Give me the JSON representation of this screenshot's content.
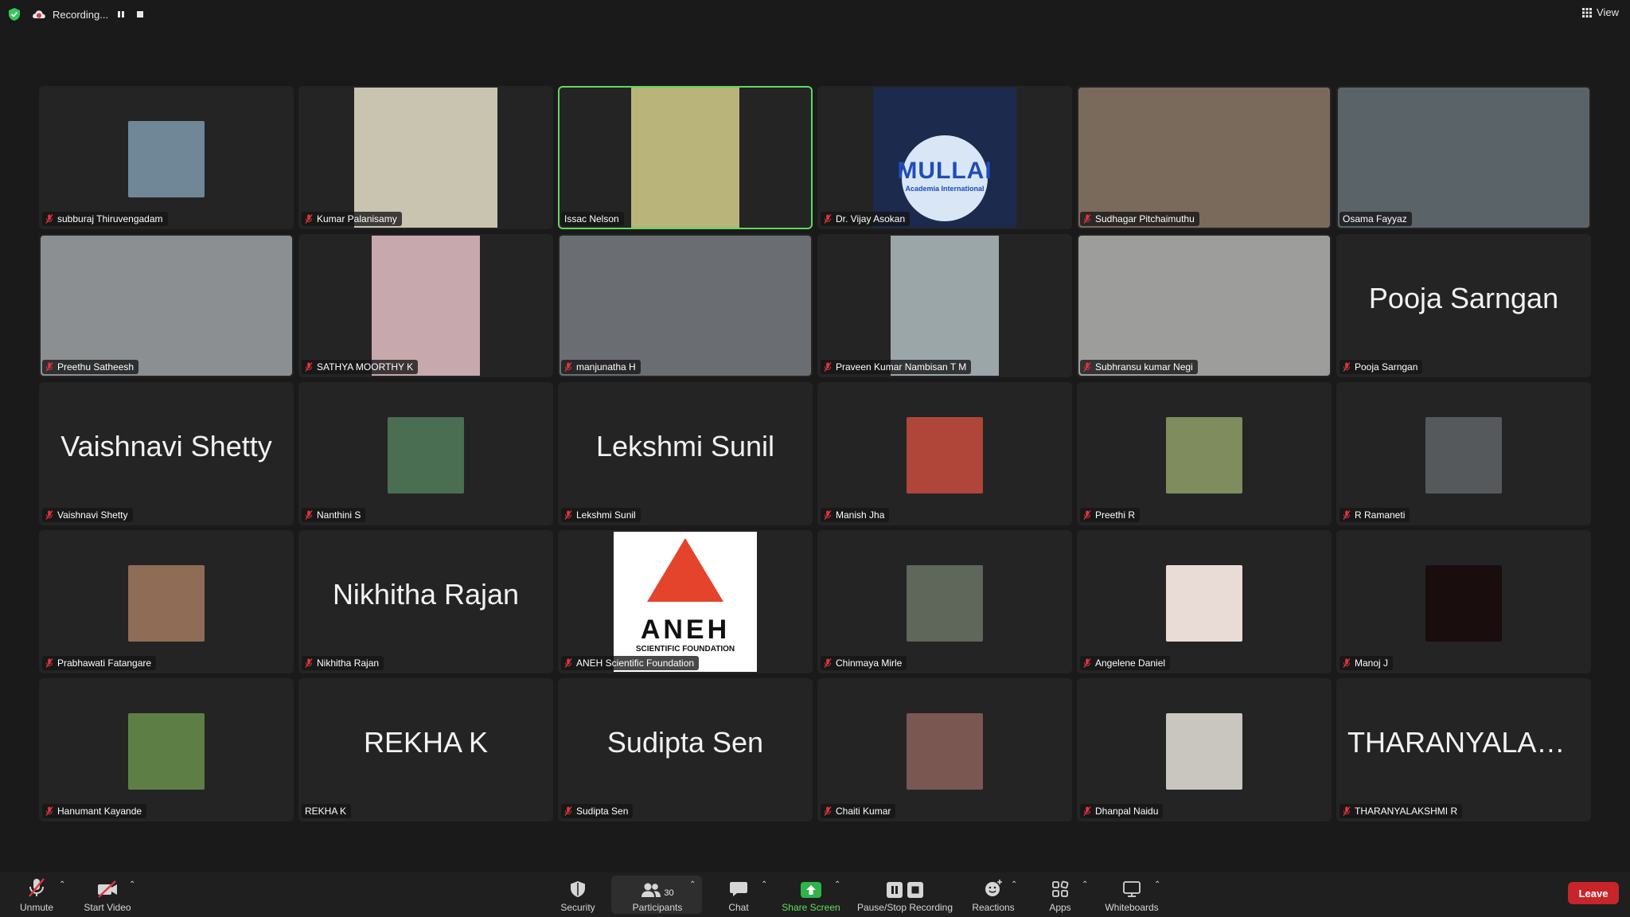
{
  "topbar": {
    "recording_label": "Recording...",
    "view_label": "View"
  },
  "tiles": [
    {
      "name": "subburaj Thiruvengadam",
      "mode": "thumb",
      "thumb_color": "#6f8797",
      "muted": true
    },
    {
      "name": "Kumar Palanisamy",
      "mode": "video",
      "video_color": "#c9c4b0",
      "video_w": 180,
      "muted": true
    },
    {
      "name": "Issac Nelson",
      "mode": "video",
      "video_color": "#b8b47a",
      "video_w": 136,
      "muted": false,
      "active": true
    },
    {
      "name": "Dr. Vijay Asokan",
      "mode": "video",
      "video_color": "#1b2a4d",
      "video_w": 180,
      "muted": true,
      "logo_text": "MULLAI",
      "logo_sub": "Academia International"
    },
    {
      "name": "Sudhagar Pitchaimuthu",
      "mode": "video",
      "video_color": "#7a6a5c",
      "video_w": 320,
      "muted": true
    },
    {
      "name": "Osama Fayyaz",
      "mode": "video",
      "video_color": "#5a6468",
      "video_w": 320,
      "muted": false
    },
    {
      "name": "Preethu Satheesh",
      "mode": "video",
      "video_color": "#8b8f92",
      "video_w": 320,
      "muted": true
    },
    {
      "name": "SATHYA MOORTHY K",
      "mode": "video",
      "video_color": "#c7a9ad",
      "video_w": 136,
      "muted": true
    },
    {
      "name": "manjunatha H",
      "mode": "video",
      "video_color": "#6a6e72",
      "video_w": 320,
      "muted": true
    },
    {
      "name": "Praveen Kumar Nambisan T M",
      "mode": "video",
      "video_color": "#9aa6a8",
      "video_w": 136,
      "muted": true
    },
    {
      "name": "Subhransu kumar Negi",
      "mode": "video",
      "video_color": "#9d9e9c",
      "video_w": 320,
      "muted": true
    },
    {
      "name": "Pooja Sarngan",
      "mode": "name",
      "muted": true
    },
    {
      "name": "Vaishnavi Shetty",
      "mode": "name",
      "muted": true
    },
    {
      "name": "Nanthini S",
      "mode": "thumb",
      "thumb_color": "#4a6e52",
      "muted": true
    },
    {
      "name": "Lekshmi Sunil",
      "mode": "name",
      "muted": true
    },
    {
      "name": "Manish Jha",
      "mode": "thumb",
      "thumb_color": "#b0453a",
      "muted": true
    },
    {
      "name": "Preethi R",
      "mode": "thumb",
      "thumb_color": "#7e8c5e",
      "muted": true
    },
    {
      "name": "R Ramaneti",
      "mode": "thumb",
      "thumb_color": "#55595c",
      "muted": true
    },
    {
      "name": "Prabhawati Fatangare",
      "mode": "thumb",
      "thumb_color": "#8e6c55",
      "muted": true
    },
    {
      "name": "Nikhitha Rajan",
      "mode": "name",
      "muted": true
    },
    {
      "name": "ANEH Scientific Foundation",
      "mode": "video",
      "video_color": "#ffffff",
      "video_w": 180,
      "muted": true,
      "logo_text": "ANEH",
      "logo_sub": "SCIENTIFIC FOUNDATION"
    },
    {
      "name": "Chinmaya Mirle",
      "mode": "thumb",
      "thumb_color": "#5f665a",
      "muted": true
    },
    {
      "name": "Angelene Daniel",
      "mode": "thumb",
      "thumb_color": "#e9dcd6",
      "muted": true
    },
    {
      "name": "Manoj J",
      "mode": "thumb",
      "thumb_color": "#1a0d0d",
      "muted": true
    },
    {
      "name": "Hanumant Kayande",
      "mode": "thumb",
      "thumb_color": "#5d7f45",
      "muted": true
    },
    {
      "name": "REKHA K",
      "mode": "name",
      "muted": false
    },
    {
      "name": "Sudipta Sen",
      "mode": "name",
      "muted": true
    },
    {
      "name": "Chaiti Kumar",
      "mode": "thumb",
      "thumb_color": "#7a5750",
      "muted": true
    },
    {
      "name": "Dhanpal Naidu",
      "mode": "thumb",
      "thumb_color": "#c9c6c0",
      "muted": true
    },
    {
      "name": "THARANYALAKSHMI R",
      "big": "THARANYALAKS...",
      "mode": "name",
      "muted": true
    }
  ],
  "toolbar": {
    "unmute": "Unmute",
    "start_video": "Start Video",
    "security": "Security",
    "participants": "Participants",
    "participants_count": "30",
    "chat": "Chat",
    "share_screen": "Share Screen",
    "pause_stop_recording": "Pause/Stop Recording",
    "reactions": "Reactions",
    "apps": "Apps",
    "whiteboards": "Whiteboards",
    "leave": "Leave"
  },
  "colors": {
    "background": "#1a1a1a",
    "tile": "#242424",
    "active_border": "#5fd95f",
    "share_green": "#5ce05c",
    "leave_red": "#c7252a",
    "mute_red": "#e0353a"
  }
}
